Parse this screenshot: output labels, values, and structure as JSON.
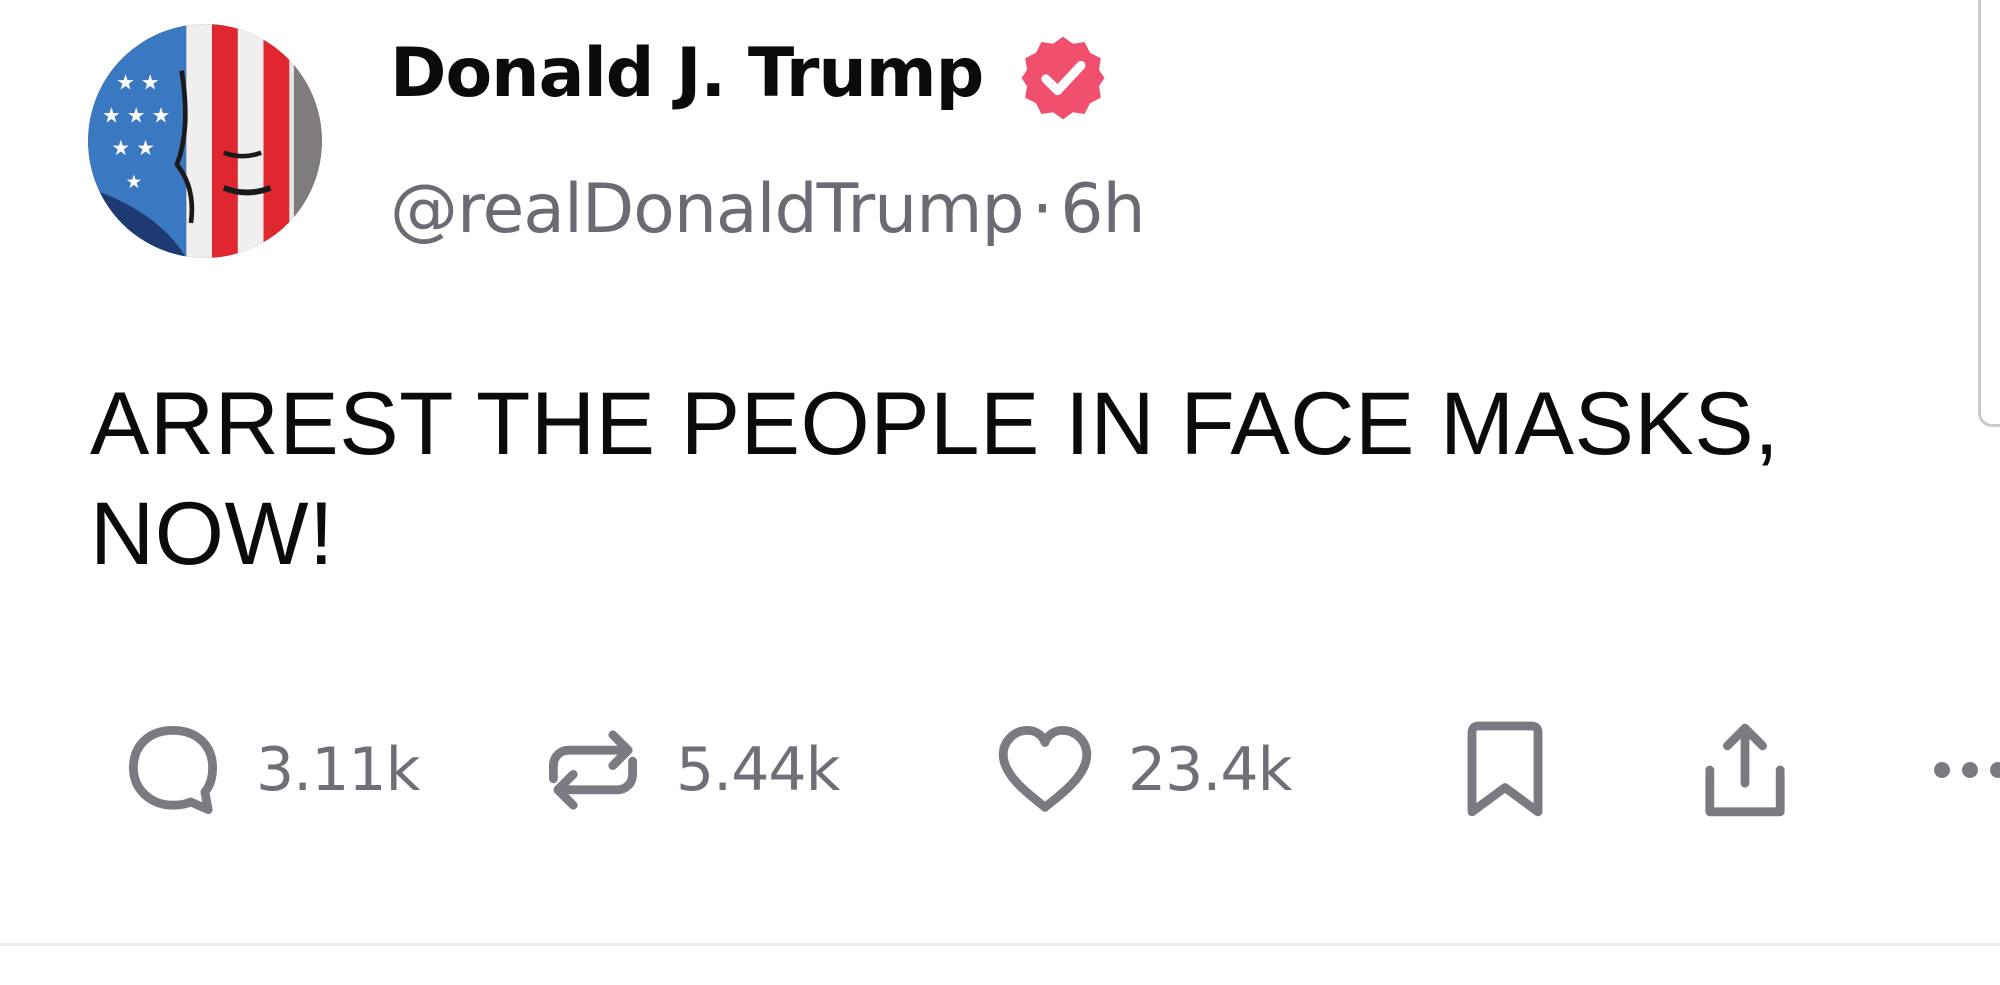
{
  "author": {
    "display_name": "Donald J. Trump",
    "handle": "@realDonaldTrump",
    "separator": "·",
    "timestamp": "6h",
    "verified_badge": "verified-badge-icon",
    "badge_color": "#f0506e"
  },
  "post": {
    "text": "ARREST THE PEOPLE IN FACE MASKS, NOW!"
  },
  "actions": {
    "reply_count": "3.11k",
    "repost_count": "5.44k",
    "like_count": "23.4k",
    "icons": [
      "reply-icon",
      "repost-icon",
      "like-icon",
      "bookmark-icon",
      "share-icon",
      "more-icon"
    ],
    "icon_color": "#7a7a82"
  }
}
